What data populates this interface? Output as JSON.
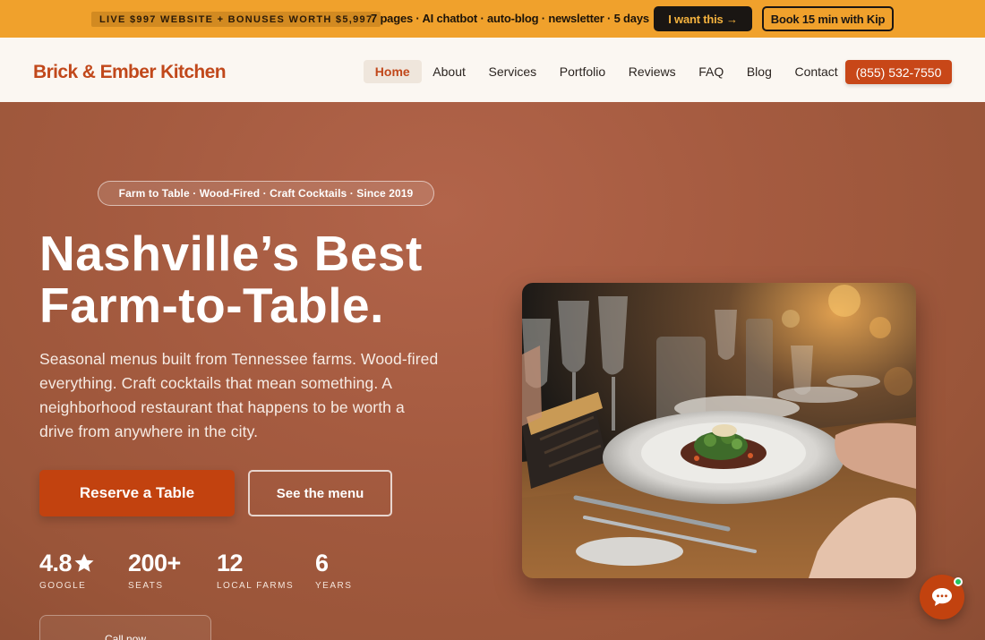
{
  "promo": {
    "tag": "LIVE $997 WEBSITE + BONUSES WORTH $5,997",
    "text": "7 pages · AI chatbot · auto-blog · newsletter · 5 days",
    "primary_button": "I want this →",
    "secondary_button": "Book 15 min with Kip"
  },
  "header": {
    "logo": "Brick & Ember Kitchen",
    "nav": [
      "Home",
      "About",
      "Services",
      "Portfolio",
      "Reviews",
      "FAQ",
      "Blog",
      "Contact"
    ],
    "active_nav": "Home",
    "phone": "(855) 532-7550"
  },
  "hero": {
    "pill": "Farm to Table · Wood-Fired · Craft Cocktails · Since 2019",
    "headline_line1": "Nashville’s Best",
    "headline_line2": "Farm-to-Table.",
    "subtext": "Seasonal menus built from Tennessee farms. Wood-fired everything. Craft cocktails that mean something. A neighborhood restaurant that happens to be worth a drive from anywhere in the city.",
    "cta_primary": "Reserve a Table",
    "cta_secondary": "See the menu",
    "stats": [
      {
        "value": "4.8",
        "label": "GOOGLE",
        "icon": "star-icon"
      },
      {
        "value": "200+",
        "label": "SEATS"
      },
      {
        "value": "12",
        "label": "LOCAL FARMS"
      },
      {
        "value": "6",
        "label": "YEARS"
      }
    ],
    "call_card": "Call now"
  },
  "chat": {
    "icon": "chat-bubble-icon",
    "status_color": "#22c55e"
  },
  "colors": {
    "brand": "#c1481b",
    "promo": "#f0a12c",
    "hero": "#a55b40"
  }
}
